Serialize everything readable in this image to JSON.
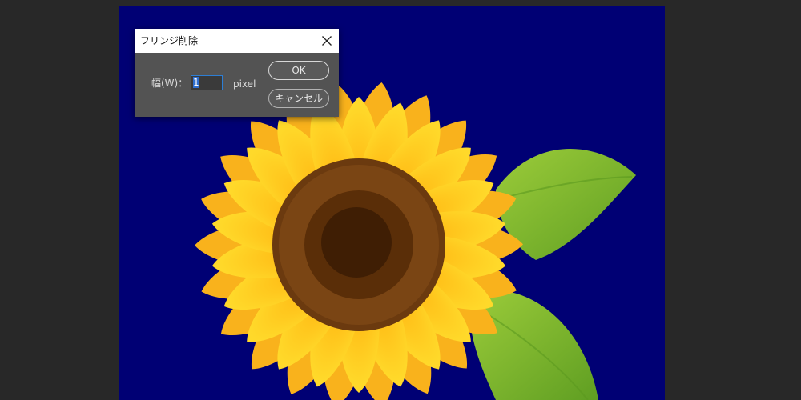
{
  "dialog": {
    "title": "フリンジ削除",
    "width_label": "幅(W)：",
    "width_value": "1",
    "unit": "pixel",
    "ok_label": "OK",
    "cancel_label": "キャンセル"
  },
  "icons": {
    "close": "close-icon"
  },
  "colors": {
    "workspace": "#282828",
    "canvas_background": "#000074",
    "dialog_body": "#535353",
    "dialog_titlebar": "#ffffff",
    "input_focus": "#2d7ed4",
    "petal": "#ffc21a",
    "seed_center": "#6b3a0f",
    "leaf": "#7dbb2a"
  }
}
